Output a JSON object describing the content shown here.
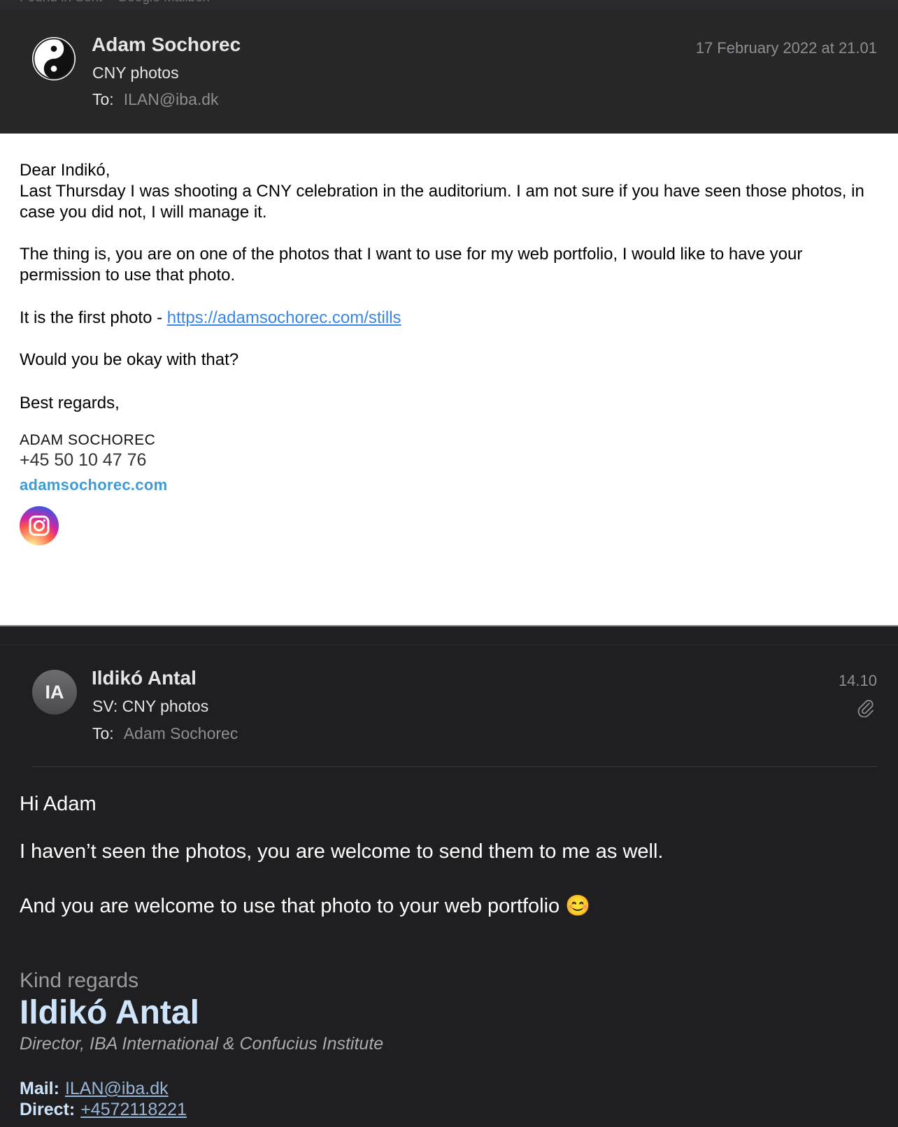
{
  "mailbox_label": "Found in Sent – Google Mailbox",
  "message1": {
    "sender": "Adam Sochorec",
    "subject": "CNY photos",
    "to_label": "To:",
    "to": "ILAN@iba.dk",
    "date": "17 February 2022 at 21.01",
    "greeting": "Dear Indikó,",
    "para1": "Last Thursday I was shooting a CNY celebration in the auditorium. I am not sure if you have seen those photos, in case you did not, I will manage it.",
    "para2": "The thing is, you are on one of the photos that I want to use for my web portfolio, I would like to have your permission to use that photo.",
    "para3_text": "It is the first photo - ",
    "para3_link": "https://adamsochorec.com/stills",
    "para4": "Would you be okay with that?",
    "closing": "Best regards,",
    "signature": {
      "name": "ADAM SOCHOREC",
      "phone": "+45 50 10 47 76",
      "website": "adamsochorec.com",
      "instagram_icon": "instagram-icon"
    }
  },
  "message2": {
    "sender": "Ildikó Antal",
    "avatar_initials": "IA",
    "subject": "SV: CNY photos",
    "to_label": "To:",
    "to": "Adam Sochorec",
    "time": "14.10",
    "attachment_icon": "paperclip-icon",
    "greeting": "Hi Adam",
    "line1": "I haven’t seen the photos, you are welcome to send them to me as well.",
    "line2": "And you are welcome to use that photo to your web portfolio 😊",
    "signature": {
      "closing": "Kind regards",
      "name": "Ildikó Antal",
      "title": "Director, IBA International & Confucius Institute",
      "mail_label": "Mail:",
      "mail": "ILAN@iba.dk",
      "direct_label": "Direct:",
      "direct": "+4572118221"
    }
  },
  "colors": {
    "header_bg": "#272728",
    "body_dark_bg": "#1f1f21",
    "link_blue": "#3a86e8",
    "signature_name_blue": "#cde4fb"
  }
}
